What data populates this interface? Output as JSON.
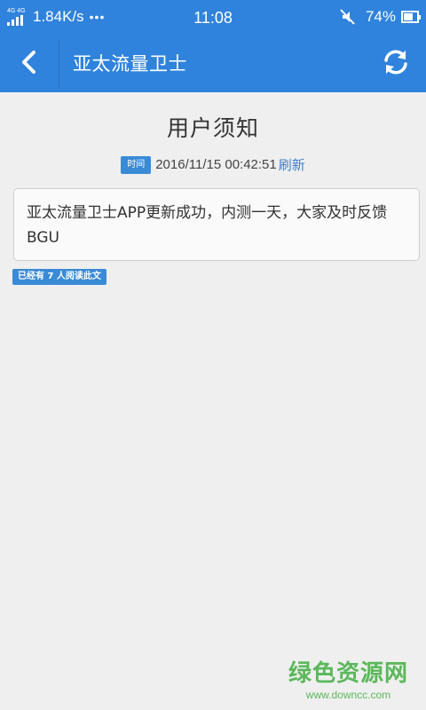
{
  "status_bar": {
    "network": "4G 4G",
    "speed": "1.84K/s",
    "dots": "•••",
    "time": "11:08",
    "battery": "74%",
    "battery_level": 0.74
  },
  "app_bar": {
    "title": "亚太流量卫士",
    "color": "#2f83dc"
  },
  "notice": {
    "heading": "用户须知",
    "time_badge": "时间",
    "timestamp": "2016/11/15 00:42:51",
    "refresh_label": "刷新",
    "body": "亚太流量卫士APP更新成功，内测一天，大家及时反馈BGU",
    "read_count": "已经有 7 人阅读此文"
  },
  "watermark": {
    "main": "绿色资源网",
    "sub": "www.downcc.com"
  },
  "icons": {
    "back": "chevron-left-icon",
    "refresh": "refresh-icon",
    "mute": "mute-icon"
  }
}
